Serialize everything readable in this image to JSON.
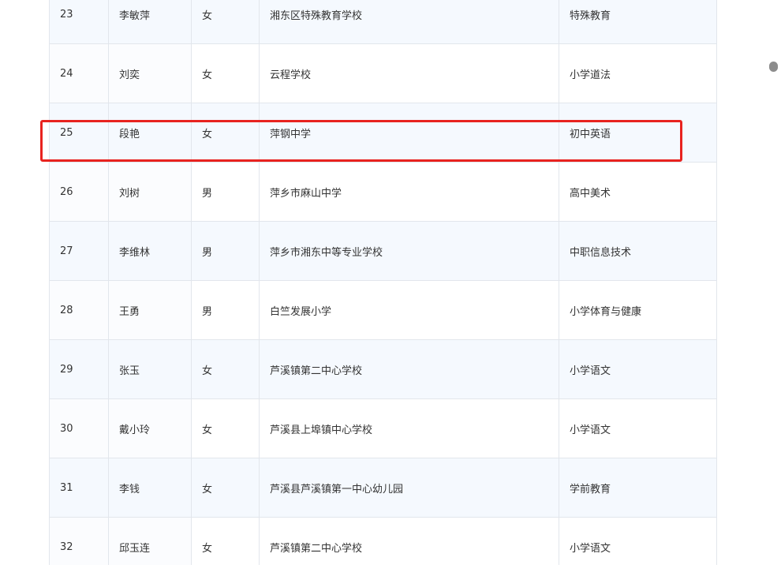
{
  "table": {
    "rows": [
      {
        "no": "23",
        "name": "李敏萍",
        "gender": "女",
        "school": "湘东区特殊教育学校",
        "subject": "特殊教育"
      },
      {
        "no": "24",
        "name": "刘奕",
        "gender": "女",
        "school": "云程学校",
        "subject": "小学道法"
      },
      {
        "no": "25",
        "name": "段艳",
        "gender": "女",
        "school": "萍钢中学",
        "subject": "初中英语"
      },
      {
        "no": "26",
        "name": "刘树",
        "gender": "男",
        "school": "萍乡市麻山中学",
        "subject": "高中美术"
      },
      {
        "no": "27",
        "name": "李维林",
        "gender": "男",
        "school": "萍乡市湘东中等专业学校",
        "subject": "中职信息技术"
      },
      {
        "no": "28",
        "name": "王勇",
        "gender": "男",
        "school": "白竺发展小学",
        "subject": "小学体育与健康"
      },
      {
        "no": "29",
        "name": "张玉",
        "gender": "女",
        "school": "芦溪镇第二中心学校",
        "subject": "小学语文"
      },
      {
        "no": "30",
        "name": "戴小玲",
        "gender": "女",
        "school": "芦溪县上埠镇中心学校",
        "subject": "小学语文"
      },
      {
        "no": "31",
        "name": "李钱",
        "gender": "女",
        "school": "芦溪县芦溪镇第一中心幼儿园",
        "subject": "学前教育"
      },
      {
        "no": "32",
        "name": "邱玉连",
        "gender": "女",
        "school": "芦溪镇第二中心学校",
        "subject": "小学语文"
      }
    ]
  },
  "highlight": {
    "row_no": "25",
    "color": "#e8231f"
  },
  "colors": {
    "border": "#e2e6ec",
    "row_tint": "#f5f9fe",
    "text": "#333333"
  }
}
